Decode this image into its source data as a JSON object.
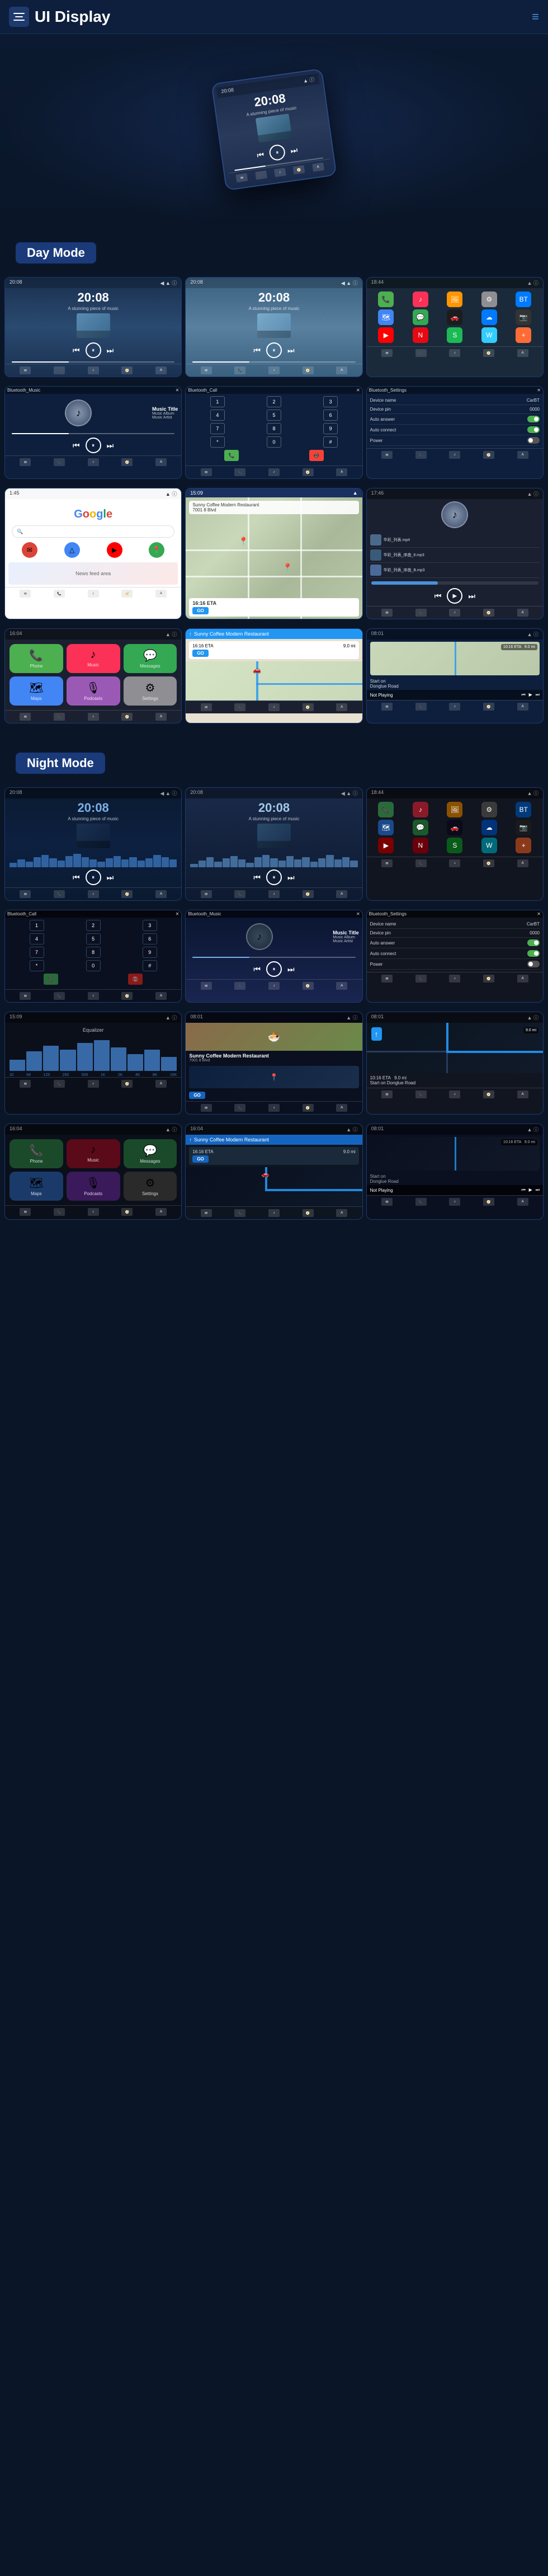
{
  "header": {
    "title": "UI Display",
    "menu_label": "menu",
    "nav_icon": "≡"
  },
  "sections": {
    "day_mode": "Day Mode",
    "night_mode": "Night Mode"
  },
  "device": {
    "time": "20:08",
    "status_left": "20:08",
    "status_right": ""
  },
  "music": {
    "title": "Music Title",
    "album": "Music Album",
    "artist": "Music Artist",
    "bluetooth_music": "Bluetooth_Music",
    "bluetooth_call": "Bluetooth_Call",
    "bluetooth_settings": "Bluetooth_Settings"
  },
  "settings": {
    "device_name_label": "Device name",
    "device_name_val": "CarBT",
    "device_pin_label": "Device pin",
    "device_pin_val": "0000",
    "auto_answer_label": "Auto answer",
    "auto_connect_label": "Auto connect",
    "power_label": "Power"
  },
  "nav": {
    "eta_label": "10:16 ETA",
    "distance": "9.0 mi",
    "start_on": "Start on",
    "road": "Donglue Road",
    "not_playing": "Not Playing",
    "go": "GO",
    "coffee_shop": "Sunny Coffee Modern Restaurant",
    "address": "7001 8 Blvd",
    "time_label": "16:16 ETA"
  },
  "app_colors": {
    "phone": "#4CAF50",
    "maps": "#4285F4",
    "messages": "#34A853",
    "music": "#FC3158",
    "podcasts": "#9B59B6",
    "settings": "#8E8E93",
    "carplay": "#1C1C1E"
  },
  "wave_heights_day": [
    8,
    14,
    10,
    18,
    22,
    16,
    12,
    20,
    24,
    18,
    14,
    10,
    16,
    20,
    14,
    18,
    12,
    16,
    22,
    18,
    14
  ],
  "wave_heights_night": [
    6,
    12,
    18,
    10,
    16,
    20,
    14,
    8,
    18,
    22,
    16,
    12,
    20,
    14,
    18,
    10,
    16,
    22,
    14,
    18,
    12
  ]
}
